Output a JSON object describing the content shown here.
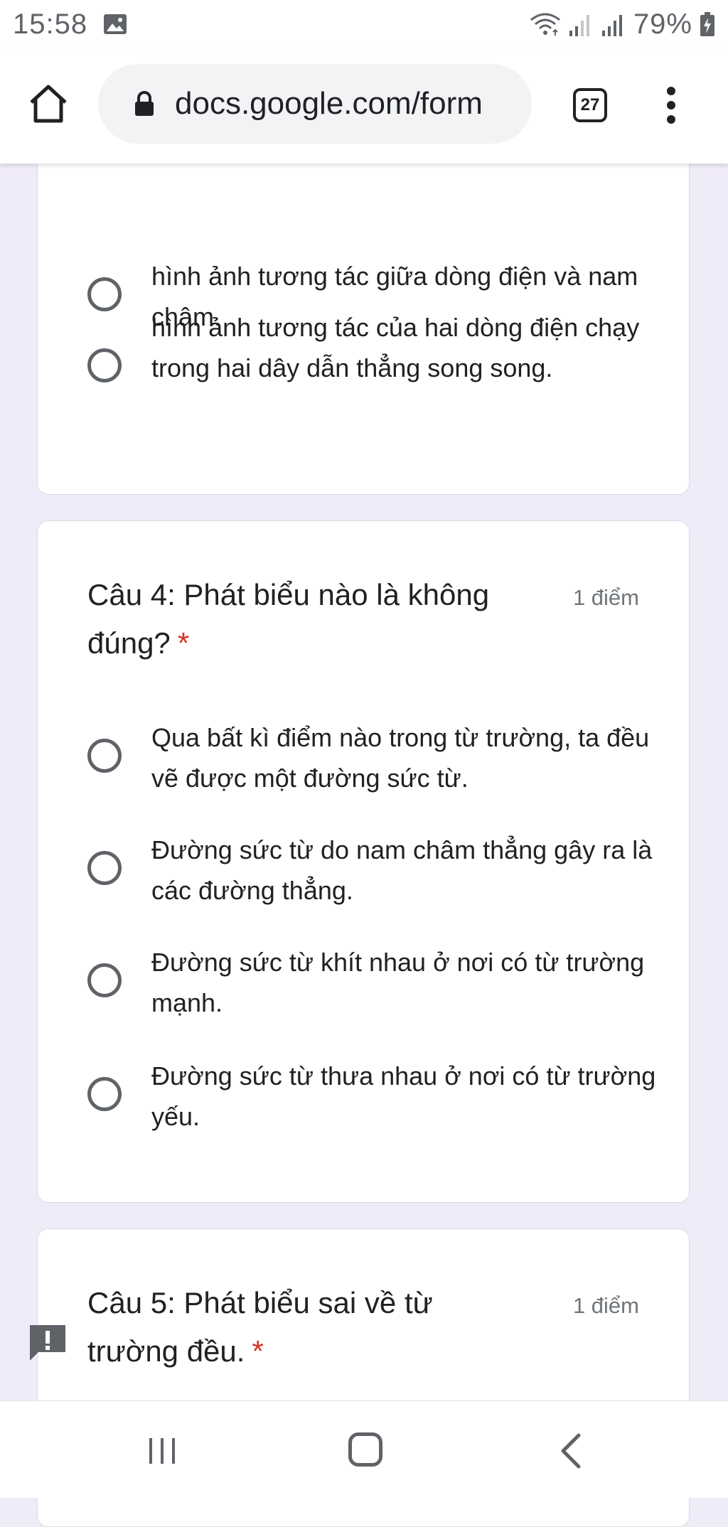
{
  "statusbar": {
    "time": "15:58",
    "battery": "79%",
    "icons": [
      "image-notification-icon",
      "wifi-icon",
      "signal-icon",
      "signal-icon",
      "battery-charging-icon"
    ]
  },
  "browser": {
    "url": "docs.google.com/form",
    "tab_count": "27",
    "icons": [
      "home-icon",
      "lock-icon",
      "more-vert-icon"
    ]
  },
  "questions": [
    {
      "options": [
        "hình ảnh tương tác giữa dòng điện và nam châm.",
        "hình ảnh tương tác của hai dòng điện chạy trong hai dây dẫn thẳng song song."
      ]
    },
    {
      "title": "Câu 4: Phát biểu nào là không đúng?",
      "required_mark": "*",
      "points": "1 điểm",
      "options": [
        "Qua bất kì điểm nào trong từ trường, ta đều vẽ được một đường sức từ.",
        "Đường sức từ do nam châm thẳng gây ra là các đường thẳng.",
        "Đường sức từ khít nhau ở nơi có từ trường mạnh.",
        "Đường sức từ thưa nhau ở nơi có từ trường yếu."
      ]
    },
    {
      "title": "Câu 5: Phát biểu sai về từ trường đều.",
      "required_mark": "*",
      "points": "1 điểm"
    }
  ],
  "colors": {
    "page_background": "#f0ebf8",
    "required": "#d93025",
    "radio": "#5f6368"
  },
  "navbar": {
    "icons": [
      "recents-icon",
      "home-nav-icon",
      "back-icon"
    ]
  }
}
